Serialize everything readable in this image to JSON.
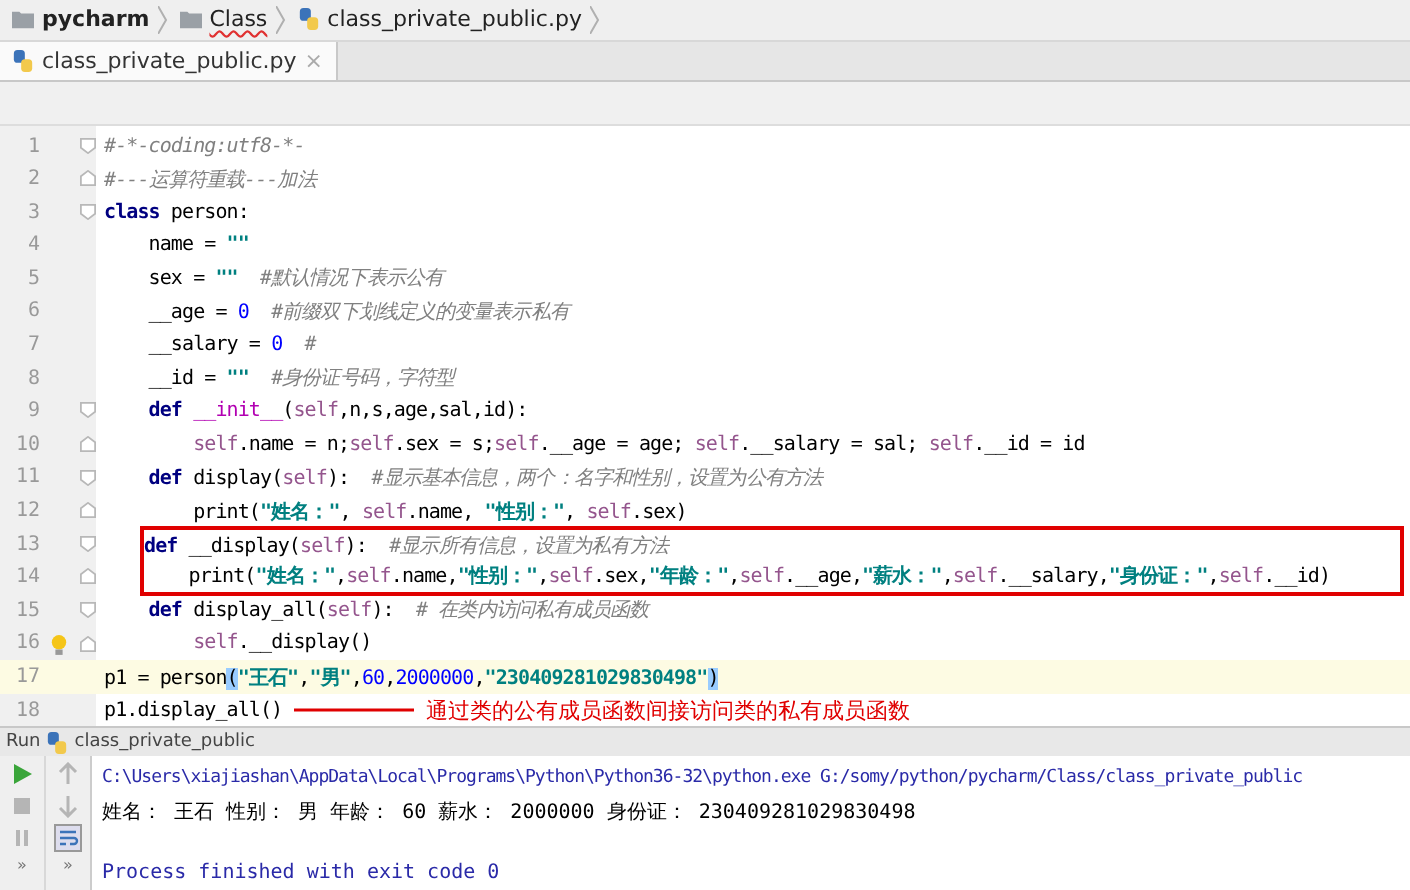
{
  "breadcrumbs": [
    {
      "label": "pycharm",
      "kind": "folder",
      "bold": true,
      "misspelled": false
    },
    {
      "label": "Class",
      "kind": "folder",
      "bold": false,
      "misspelled": true
    },
    {
      "label": "class_private_public.py",
      "kind": "python",
      "bold": false,
      "misspelled": false
    }
  ],
  "tabs": [
    {
      "label": "class_private_public.py",
      "selected": true,
      "close": "×"
    }
  ],
  "editor": {
    "lines": [
      {
        "number": "1",
        "fold_open": true,
        "fold_close": false,
        "boxed": false,
        "current": false,
        "bulb": false,
        "tokens": [
          {
            "t": "#-*-coding:utf8-*-",
            "kind": "cmt"
          }
        ]
      },
      {
        "number": "2",
        "fold_open": false,
        "fold_close": true,
        "boxed": false,
        "current": false,
        "bulb": false,
        "tokens": [
          {
            "t": "#---运算符重载---加法",
            "kind": "cmt"
          }
        ]
      },
      {
        "number": "3",
        "fold_open": true,
        "fold_close": false,
        "boxed": false,
        "current": false,
        "bulb": false,
        "tokens": [
          {
            "t": "class",
            "kind": "kw"
          },
          {
            "t": " person:",
            "kind": "plain"
          }
        ]
      },
      {
        "number": "4",
        "fold_open": false,
        "fold_close": false,
        "boxed": false,
        "current": false,
        "bulb": false,
        "tokens": [
          {
            "t": "    name = ",
            "kind": "plain"
          },
          {
            "t": "\"\"",
            "kind": "str"
          }
        ]
      },
      {
        "number": "5",
        "fold_open": false,
        "fold_close": false,
        "boxed": false,
        "current": false,
        "bulb": false,
        "tokens": [
          {
            "t": "    sex = ",
            "kind": "plain"
          },
          {
            "t": "\"\"",
            "kind": "str"
          },
          {
            "t": "  #默认情况下表示公有",
            "kind": "cmt"
          }
        ]
      },
      {
        "number": "6",
        "fold_open": false,
        "fold_close": false,
        "boxed": false,
        "current": false,
        "bulb": false,
        "tokens": [
          {
            "t": "    __age = ",
            "kind": "plain"
          },
          {
            "t": "0",
            "kind": "num"
          },
          {
            "t": "  #前缀双下划线定义的变量表示私有",
            "kind": "cmt"
          }
        ]
      },
      {
        "number": "7",
        "fold_open": false,
        "fold_close": false,
        "boxed": false,
        "current": false,
        "bulb": false,
        "tokens": [
          {
            "t": "    __salary = ",
            "kind": "plain"
          },
          {
            "t": "0",
            "kind": "num"
          },
          {
            "t": "  #",
            "kind": "cmt"
          }
        ]
      },
      {
        "number": "8",
        "fold_open": false,
        "fold_close": false,
        "boxed": false,
        "current": false,
        "bulb": false,
        "tokens": [
          {
            "t": "    __id = ",
            "kind": "plain"
          },
          {
            "t": "\"\"",
            "kind": "str"
          },
          {
            "t": "  #身份证号码，字符型",
            "kind": "cmt"
          }
        ]
      },
      {
        "number": "9",
        "fold_open": true,
        "fold_close": false,
        "boxed": false,
        "current": false,
        "bulb": false,
        "tokens": [
          {
            "t": "    def ",
            "kind": "kw"
          },
          {
            "t": "__init__",
            "kind": "fn"
          },
          {
            "t": "(",
            "kind": "plain"
          },
          {
            "t": "self",
            "kind": "self"
          },
          {
            "t": ",n,s,age,sal,id):",
            "kind": "plain"
          }
        ]
      },
      {
        "number": "10",
        "fold_open": false,
        "fold_close": true,
        "boxed": false,
        "current": false,
        "bulb": false,
        "tokens": [
          {
            "t": "        self",
            "kind": "self"
          },
          {
            "t": ".name = n;",
            "kind": "plain"
          },
          {
            "t": "self",
            "kind": "self"
          },
          {
            "t": ".sex = s;",
            "kind": "plain"
          },
          {
            "t": "self",
            "kind": "self"
          },
          {
            "t": ".__age = age; ",
            "kind": "plain"
          },
          {
            "t": "self",
            "kind": "self"
          },
          {
            "t": ".__salary = sal; ",
            "kind": "plain"
          },
          {
            "t": "self",
            "kind": "self"
          },
          {
            "t": ".__id = id",
            "kind": "plain"
          }
        ]
      },
      {
        "number": "11",
        "fold_open": true,
        "fold_close": false,
        "boxed": false,
        "current": false,
        "bulb": false,
        "tokens": [
          {
            "t": "    def",
            "kind": "kw"
          },
          {
            "t": " display(",
            "kind": "plain"
          },
          {
            "t": "self",
            "kind": "self"
          },
          {
            "t": "):",
            "kind": "plain"
          },
          {
            "t": "  #显示基本信息，两个：名字和性别，设置为公有方法",
            "kind": "cmt"
          }
        ]
      },
      {
        "number": "12",
        "fold_open": false,
        "fold_close": true,
        "boxed": false,
        "current": false,
        "bulb": false,
        "tokens": [
          {
            "t": "        print(",
            "kind": "plain"
          },
          {
            "t": "\"姓名：\"",
            "kind": "str"
          },
          {
            "t": ", ",
            "kind": "plain"
          },
          {
            "t": "self",
            "kind": "self"
          },
          {
            "t": ".name, ",
            "kind": "plain"
          },
          {
            "t": "\"性别：\"",
            "kind": "str"
          },
          {
            "t": ", ",
            "kind": "plain"
          },
          {
            "t": "self",
            "kind": "self"
          },
          {
            "t": ".sex)",
            "kind": "plain"
          }
        ]
      },
      {
        "number": "13",
        "fold_open": true,
        "fold_close": false,
        "boxed": true,
        "current": false,
        "bulb": false,
        "tokens": [
          {
            "t": "def",
            "kind": "kw"
          },
          {
            "t": " __display(",
            "kind": "plain"
          },
          {
            "t": "self",
            "kind": "self"
          },
          {
            "t": "):",
            "kind": "plain"
          },
          {
            "t": "  #显示所有信息，设置为私有方法",
            "kind": "cmt"
          }
        ]
      },
      {
        "number": "14",
        "fold_open": false,
        "fold_close": true,
        "boxed": true,
        "current": false,
        "bulb": false,
        "tokens": [
          {
            "t": "    print(",
            "kind": "plain"
          },
          {
            "t": "\"姓名：\"",
            "kind": "str"
          },
          {
            "t": ",",
            "kind": "plain"
          },
          {
            "t": "self",
            "kind": "self"
          },
          {
            "t": ".name,",
            "kind": "plain"
          },
          {
            "t": "\"性别：\"",
            "kind": "str"
          },
          {
            "t": ",",
            "kind": "plain"
          },
          {
            "t": "self",
            "kind": "self"
          },
          {
            "t": ".sex,",
            "kind": "plain"
          },
          {
            "t": "\"年龄：\"",
            "kind": "str"
          },
          {
            "t": ",",
            "kind": "plain"
          },
          {
            "t": "self",
            "kind": "self"
          },
          {
            "t": ".__age,",
            "kind": "plain"
          },
          {
            "t": "\"薪水：\"",
            "kind": "str"
          },
          {
            "t": ",",
            "kind": "plain"
          },
          {
            "t": "self",
            "kind": "self"
          },
          {
            "t": ".__salary,",
            "kind": "plain"
          },
          {
            "t": "\"身份证：\"",
            "kind": "str"
          },
          {
            "t": ",",
            "kind": "plain"
          },
          {
            "t": "self",
            "kind": "self"
          },
          {
            "t": ".__id)",
            "kind": "plain"
          }
        ]
      },
      {
        "number": "15",
        "fold_open": true,
        "fold_close": false,
        "boxed": false,
        "current": false,
        "bulb": false,
        "tokens": [
          {
            "t": "    def",
            "kind": "kw"
          },
          {
            "t": " display_all(",
            "kind": "plain"
          },
          {
            "t": "self",
            "kind": "self"
          },
          {
            "t": "):",
            "kind": "plain"
          },
          {
            "t": "  # 在类内访问私有成员函数",
            "kind": "cmt"
          }
        ]
      },
      {
        "number": "16",
        "fold_open": false,
        "fold_close": true,
        "boxed": false,
        "current": false,
        "bulb": true,
        "tokens": [
          {
            "t": "        self",
            "kind": "self"
          },
          {
            "t": ".__display()",
            "kind": "plain"
          }
        ]
      },
      {
        "number": "17",
        "fold_open": false,
        "fold_close": false,
        "boxed": false,
        "current": true,
        "bulb": false,
        "tokens": [
          {
            "t": "p1 = person",
            "kind": "plain"
          },
          {
            "t": "(",
            "kind": "brace"
          },
          {
            "t": "\"王石\"",
            "kind": "str"
          },
          {
            "t": ",",
            "kind": "plain"
          },
          {
            "t": "\"男\"",
            "kind": "str"
          },
          {
            "t": ",",
            "kind": "plain"
          },
          {
            "t": "60",
            "kind": "num"
          },
          {
            "t": ",",
            "kind": "plain"
          },
          {
            "t": "2000000",
            "kind": "num"
          },
          {
            "t": ",",
            "kind": "plain"
          },
          {
            "t": "\"230409281029830498\"",
            "kind": "str"
          },
          {
            "t": ")",
            "kind": "brace"
          }
        ]
      },
      {
        "number": "18",
        "fold_open": false,
        "fold_close": false,
        "boxed": false,
        "current": false,
        "bulb": false,
        "tokens": [
          {
            "t": "p1.display_all()",
            "kind": "plain"
          }
        ],
        "annotation": "通过类的公有成员函数间接访问类的私有成员函数"
      }
    ]
  },
  "run": {
    "label": "Run",
    "config": "class_private_public",
    "more": [
      "»",
      "»"
    ],
    "lines": [
      {
        "kind": "command",
        "text": "C:\\Users\\xiajiashan\\AppData\\Local\\Programs\\Python\\Python36-32\\python.exe G:/somy/python/pycharm/Class/class_private_public"
      },
      {
        "kind": "output",
        "text": "姓名： 王石 性别： 男 年龄： 60 薪水： 2000000 身份证： 230409281029830498"
      },
      {
        "kind": "system",
        "text": "Process finished with exit code 0"
      }
    ]
  }
}
